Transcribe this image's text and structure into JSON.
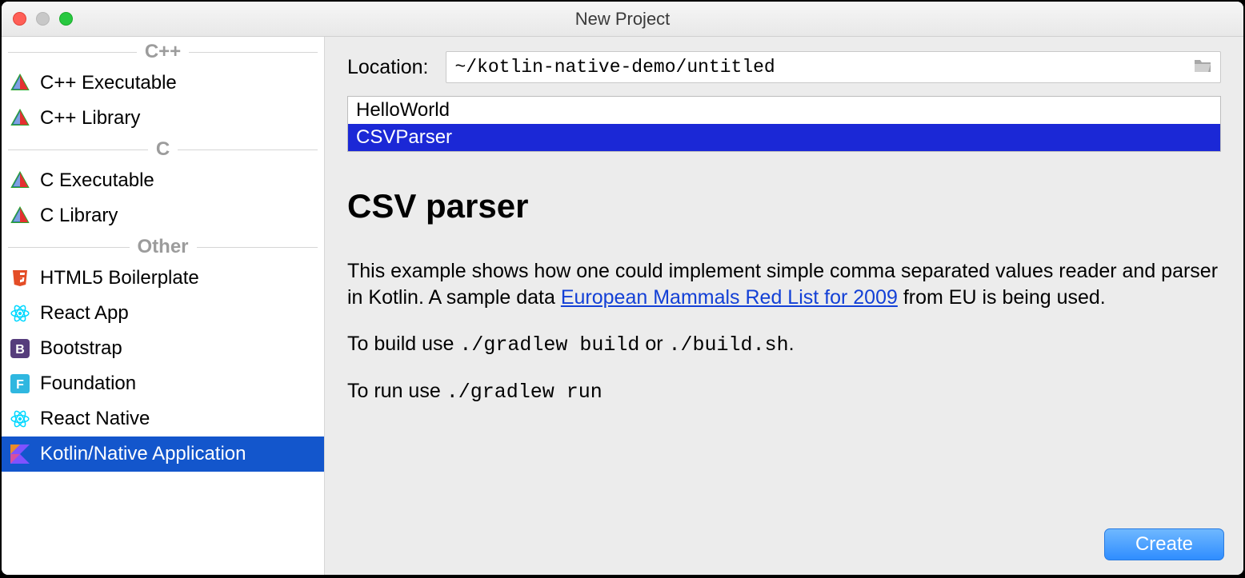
{
  "window": {
    "title": "New Project"
  },
  "sidebar": {
    "groups": [
      {
        "label": "C++",
        "items": [
          {
            "name": "cpp-executable",
            "label": "C++ Executable",
            "icon": "triangle"
          },
          {
            "name": "cpp-library",
            "label": "C++ Library",
            "icon": "triangle"
          }
        ]
      },
      {
        "label": "C",
        "items": [
          {
            "name": "c-executable",
            "label": "C Executable",
            "icon": "triangle"
          },
          {
            "name": "c-library",
            "label": "C Library",
            "icon": "triangle"
          }
        ]
      },
      {
        "label": "Other",
        "items": [
          {
            "name": "html5-boilerplate",
            "label": "HTML5 Boilerplate",
            "icon": "html5"
          },
          {
            "name": "react-app",
            "label": "React App",
            "icon": "react"
          },
          {
            "name": "bootstrap",
            "label": "Bootstrap",
            "icon": "bootstrap"
          },
          {
            "name": "foundation",
            "label": "Foundation",
            "icon": "foundation"
          },
          {
            "name": "react-native",
            "label": "React Native",
            "icon": "react"
          },
          {
            "name": "kotlin-native",
            "label": "Kotlin/Native Application",
            "icon": "kotlin",
            "selected": true
          }
        ]
      }
    ]
  },
  "main": {
    "location_label": "Location:",
    "location_value": "~/kotlin-native-demo/untitled",
    "templates": [
      {
        "name": "hello-world",
        "label": "HelloWorld"
      },
      {
        "name": "csv-parser",
        "label": "CSVParser",
        "selected": true
      }
    ],
    "description": {
      "heading": "CSV parser",
      "para1_pre": "This example shows how one could implement simple comma separated values reader and parser in Kotlin. A sample data ",
      "link_text": "European Mammals Red List for 2009",
      "para1_post": " from EU is being used.",
      "build_pre": "To build use ",
      "build_cmd1": "./gradlew build",
      "build_mid": " or ",
      "build_cmd2": "./build.sh",
      "build_post": ".",
      "run_pre": "To run use ",
      "run_cmd": "./gradlew run"
    }
  },
  "footer": {
    "create_label": "Create"
  },
  "icons": {
    "triangle": "triangle",
    "html5": "html5",
    "react": "react",
    "bootstrap": "bootstrap",
    "foundation": "foundation",
    "kotlin": "kotlin",
    "folder": "folder"
  }
}
